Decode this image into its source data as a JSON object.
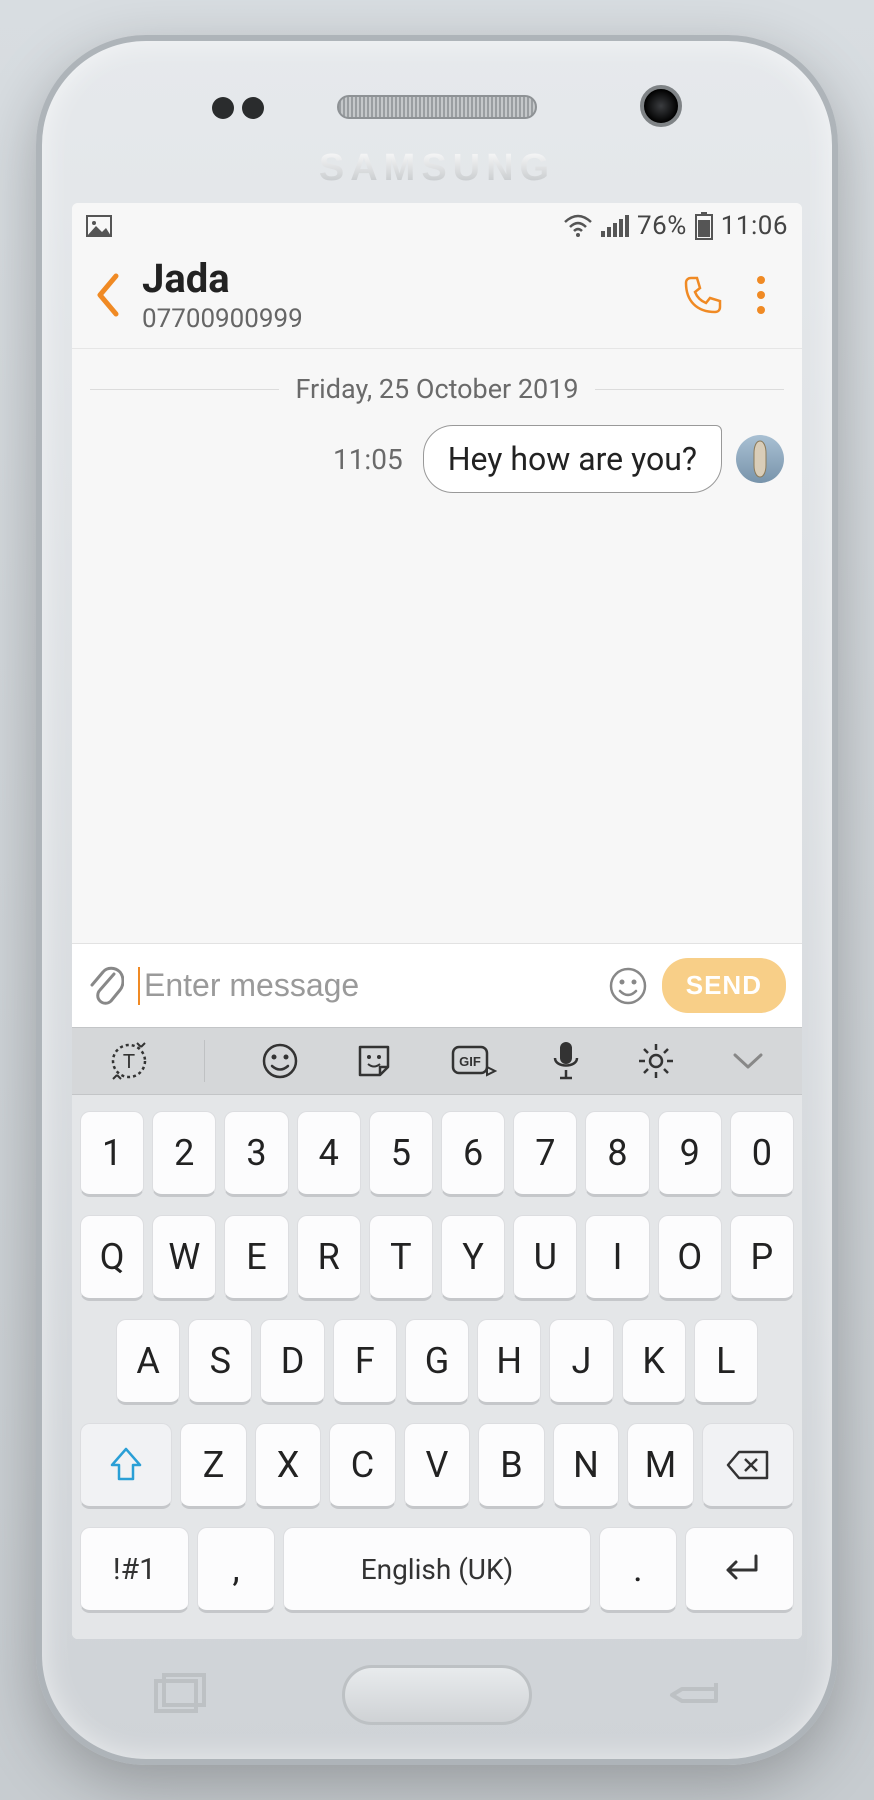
{
  "statusbar": {
    "battery_pct": "76%",
    "time": "11:06"
  },
  "header": {
    "contact_name": "Jada",
    "contact_number": "07700900999"
  },
  "thread": {
    "date": "Friday, 25 October 2019",
    "messages": [
      {
        "time": "11:05",
        "text": "Hey how are you?",
        "direction": "out"
      }
    ]
  },
  "composer": {
    "placeholder": "Enter message",
    "value": "",
    "send_label": "SEND"
  },
  "keyboard": {
    "row1": [
      "1",
      "2",
      "3",
      "4",
      "5",
      "6",
      "7",
      "8",
      "9",
      "0"
    ],
    "row2": [
      "Q",
      "W",
      "E",
      "R",
      "T",
      "Y",
      "U",
      "I",
      "O",
      "P"
    ],
    "row3": [
      "A",
      "S",
      "D",
      "F",
      "G",
      "H",
      "J",
      "K",
      "L"
    ],
    "row4_letters": [
      "Z",
      "X",
      "C",
      "V",
      "B",
      "N",
      "M"
    ],
    "symbols_label": "!#1",
    "space_label": "English (UK)",
    "comma_label": ",",
    "period_label": "."
  }
}
